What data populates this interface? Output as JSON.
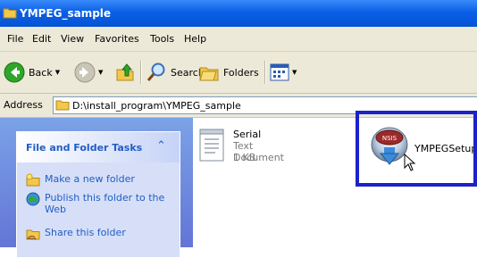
{
  "window": {
    "title": "YMPEG_sample"
  },
  "menu": {
    "items": [
      "File",
      "Edit",
      "View",
      "Favorites",
      "Tools",
      "Help"
    ]
  },
  "toolbar": {
    "back_label": "Back",
    "search_label": "Search",
    "folders_label": "Folders"
  },
  "address": {
    "label": "Address",
    "value": "D:\\install_program\\YMPEG_sample"
  },
  "tasks": {
    "header": "File and Folder Tasks",
    "items": [
      {
        "label": "Make a new folder",
        "icon": "new-folder-icon"
      },
      {
        "label": "Publish this folder to the Web",
        "icon": "publish-web-icon"
      },
      {
        "label": "Share this folder",
        "icon": "share-folder-icon"
      }
    ]
  },
  "files": [
    {
      "name": "Serial",
      "type": "Text Document",
      "size": "1 KB",
      "icon": "text-document-icon"
    },
    {
      "name": "YMPEGSetup",
      "icon": "setup-installer-icon",
      "badge": "NSIS"
    }
  ],
  "colors": {
    "titlebar": "#0a5fe6",
    "highlight_border": "#1b22c8",
    "task_link": "#215dc6"
  }
}
